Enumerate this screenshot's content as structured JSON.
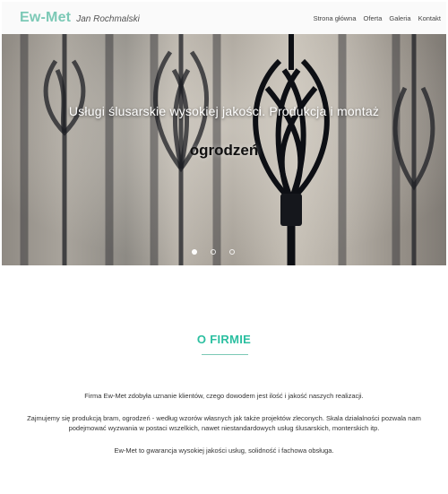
{
  "theme": {
    "accent": "#7cc9b6",
    "heading": "#2bbfa0"
  },
  "brand": {
    "name": "Ew-Met",
    "owner": "Jan Rochmalski"
  },
  "nav": {
    "items": [
      {
        "label": "Strona główna"
      },
      {
        "label": "Oferta"
      },
      {
        "label": "Galeria"
      },
      {
        "label": "Kontakt"
      }
    ]
  },
  "hero": {
    "subtitle": "Usługi ślusarskie wysokiej jakości. Produkcja i montaż",
    "title": "ogrodzeń",
    "slides": 3,
    "active_slide": 1
  },
  "about": {
    "title": "O FIRMIE",
    "paragraphs": [
      "Firma Ew-Met zdobyła uznanie klientów, czego dowodem jest ilość i jakość naszych realizacji.",
      "Zajmujemy się produkcją bram, ogrodzeń - według wzorów własnych jak także projektów zleconych. Skala działalności pozwala nam podejmować wyzwania w postaci wszelkich, nawet niestandardowych usług ślusarskich, monterskich itp.",
      "Ew-Met to gwarancja wysokiej jakości usług, solidność i fachowa obsługa."
    ]
  }
}
